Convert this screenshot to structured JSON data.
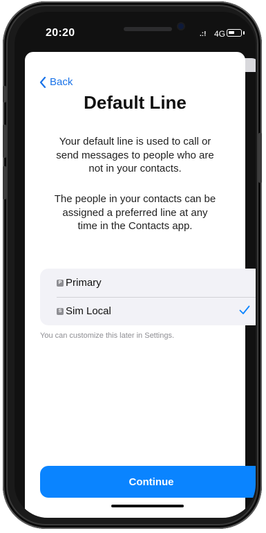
{
  "status_bar": {
    "time": "20:20",
    "signal": ".:!",
    "network": "4G"
  },
  "nav": {
    "back_label": "Back"
  },
  "page": {
    "title": "Default Line",
    "description_1": "Your default line is used to call or send messages to people who are not in your contacts.",
    "description_2": "The people in your contacts can be assigned a preferred line at any time in the Contacts app."
  },
  "lines": [
    {
      "badge": "P",
      "label": "Primary",
      "selected": false
    },
    {
      "badge": "S",
      "label": "Sim Local",
      "selected": true
    }
  ],
  "hint": "You can customize this later in Settings.",
  "actions": {
    "continue_label": "Continue"
  },
  "colors": {
    "accent": "#0a84ff",
    "link": "#1a73e8",
    "options_bg": "#f2f2f7"
  }
}
